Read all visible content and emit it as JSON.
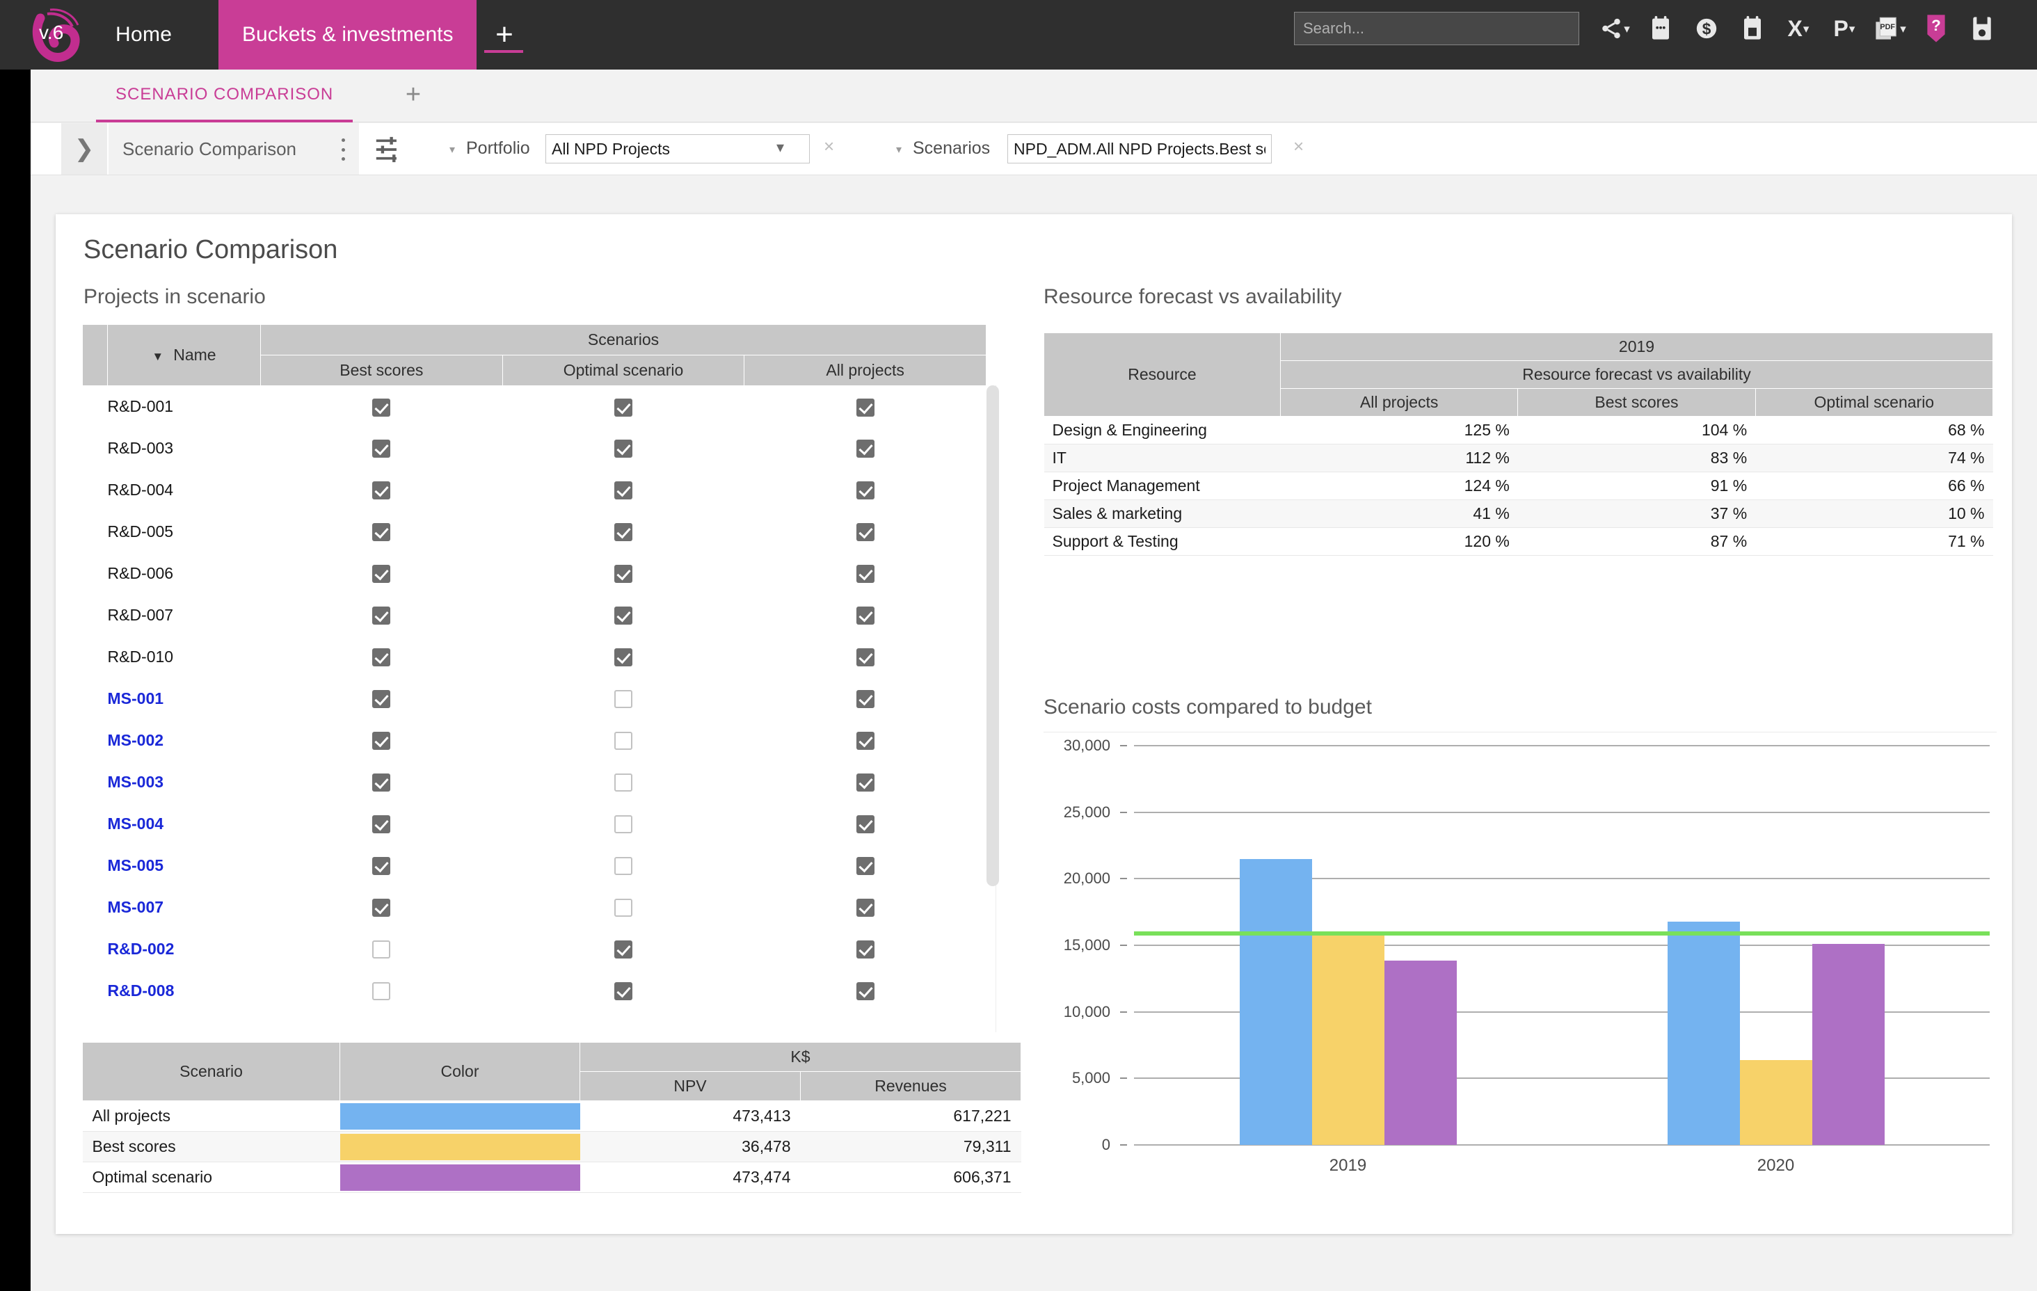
{
  "topbar": {
    "home_label": "Home",
    "active_tab_label": "Buckets & investments",
    "add_tab_label": "+",
    "search_placeholder": "Search...",
    "icons": [
      {
        "name": "share-icon",
        "caret": true
      },
      {
        "name": "calendar-notes-icon",
        "caret": false
      },
      {
        "name": "dollar-coin-icon",
        "caret": false
      },
      {
        "name": "calendar-box-icon",
        "caret": false
      },
      {
        "name": "excel-export-icon",
        "label": "X",
        "caret": true
      },
      {
        "name": "powerpoint-export-icon",
        "label": "P",
        "caret": true
      },
      {
        "name": "pdf-export-icon",
        "label": "PDF",
        "caret": true
      },
      {
        "name": "help-icon",
        "label": "?",
        "caret": false
      },
      {
        "name": "save-icon",
        "caret": false
      }
    ]
  },
  "subtabs": {
    "active_label": "SCENARIO COMPARISON",
    "add_label": "+"
  },
  "filterbar": {
    "expand_chevron": "❯",
    "view_name": "Scenario Comparison",
    "kebab_name": "more-options",
    "settings_icon": "sliders-icon",
    "portfolio_label": "Portfolio",
    "portfolio_value": "All NPD Projects",
    "portfolio_clear": "×",
    "scenarios_label": "Scenarios",
    "scenarios_value": "NPD_ADM.All NPD Projects.Best sc…",
    "scenarios_clear": "×"
  },
  "page": {
    "title": "Scenario Comparison",
    "projects_section_title": "Projects in scenario",
    "resource_section_title": "Resource forecast vs availability",
    "chart_section_title": "Scenario costs compared to budget"
  },
  "projects_table": {
    "group_header": "Scenarios",
    "name_header": "Name",
    "sort_caret": "▼",
    "scenario_columns": [
      "Best scores",
      "Optimal scenario",
      "All projects"
    ],
    "rows": [
      {
        "name": "R&D-001",
        "highlight": false,
        "checks": [
          true,
          true,
          true
        ]
      },
      {
        "name": "R&D-003",
        "highlight": false,
        "checks": [
          true,
          true,
          true
        ]
      },
      {
        "name": "R&D-004",
        "highlight": false,
        "checks": [
          true,
          true,
          true
        ]
      },
      {
        "name": "R&D-005",
        "highlight": false,
        "checks": [
          true,
          true,
          true
        ]
      },
      {
        "name": "R&D-006",
        "highlight": false,
        "checks": [
          true,
          true,
          true
        ]
      },
      {
        "name": "R&D-007",
        "highlight": false,
        "checks": [
          true,
          true,
          true
        ]
      },
      {
        "name": "R&D-010",
        "highlight": false,
        "checks": [
          true,
          true,
          true
        ]
      },
      {
        "name": "MS-001",
        "highlight": true,
        "checks": [
          true,
          false,
          true
        ]
      },
      {
        "name": "MS-002",
        "highlight": true,
        "checks": [
          true,
          false,
          true
        ]
      },
      {
        "name": "MS-003",
        "highlight": true,
        "checks": [
          true,
          false,
          true
        ]
      },
      {
        "name": "MS-004",
        "highlight": true,
        "checks": [
          true,
          false,
          true
        ]
      },
      {
        "name": "MS-005",
        "highlight": true,
        "checks": [
          true,
          false,
          true
        ]
      },
      {
        "name": "MS-007",
        "highlight": true,
        "checks": [
          true,
          false,
          true
        ]
      },
      {
        "name": "R&D-002",
        "highlight": true,
        "checks": [
          false,
          true,
          true
        ]
      },
      {
        "name": "R&D-008",
        "highlight": true,
        "checks": [
          false,
          true,
          true
        ]
      }
    ]
  },
  "summary_table": {
    "headers": {
      "scenario": "Scenario",
      "color": "Color",
      "unit": "K$",
      "npv": "NPV",
      "revenues": "Revenues"
    },
    "rows": [
      {
        "scenario": "All projects",
        "color": "#74b3f0",
        "npv": "473,413",
        "revenues": "617,221"
      },
      {
        "scenario": "Best scores",
        "color": "#f7d269",
        "npv": "36,478",
        "revenues": "79,311"
      },
      {
        "scenario": "Optimal scenario",
        "color": "#ae70c5",
        "npv": "473,474",
        "revenues": "606,371"
      }
    ]
  },
  "resource_table": {
    "resource_header": "Resource",
    "year_header": "2019",
    "metric_header": "Resource forecast vs availability",
    "columns": [
      "All projects",
      "Best scores",
      "Optimal scenario"
    ],
    "rows": [
      {
        "resource": "Design & Engineering",
        "values": [
          "125 %",
          "104 %",
          "68 %"
        ],
        "over": [
          true,
          true,
          false
        ]
      },
      {
        "resource": "IT",
        "values": [
          "112 %",
          "83 %",
          "74 %"
        ],
        "over": [
          true,
          false,
          false
        ]
      },
      {
        "resource": "Project Management",
        "values": [
          "124 %",
          "91 %",
          "66 %"
        ],
        "over": [
          true,
          false,
          false
        ]
      },
      {
        "resource": "Sales & marketing",
        "values": [
          "41 %",
          "37 %",
          "10 %"
        ],
        "over": [
          false,
          false,
          false
        ]
      },
      {
        "resource": "Support & Testing",
        "values": [
          "120 %",
          "87 %",
          "71 %"
        ],
        "over": [
          true,
          false,
          false
        ]
      }
    ]
  },
  "chart_data": {
    "type": "bar",
    "title": "Scenario costs compared to budget",
    "xlabel": "",
    "ylabel": "",
    "categories": [
      "2019",
      "2020"
    ],
    "ylim": [
      0,
      30000
    ],
    "yticks": [
      0,
      5000,
      10000,
      15000,
      20000,
      25000,
      30000
    ],
    "ytick_labels": [
      "0",
      "5,000",
      "10,000",
      "15,000",
      "20,000",
      "25,000",
      "30,000"
    ],
    "grid": true,
    "legend": "none",
    "series": [
      {
        "name": "All projects",
        "color": "#74b3f0",
        "values": [
          21500,
          16800
        ]
      },
      {
        "name": "Best scores",
        "color": "#f7d269",
        "values": [
          15900,
          6400
        ]
      },
      {
        "name": "Optimal scenario",
        "color": "#ae70c5",
        "values": [
          13850,
          15100
        ]
      }
    ],
    "reference_line": {
      "name": "Budget",
      "value": 15900,
      "color": "#79e05a"
    }
  }
}
